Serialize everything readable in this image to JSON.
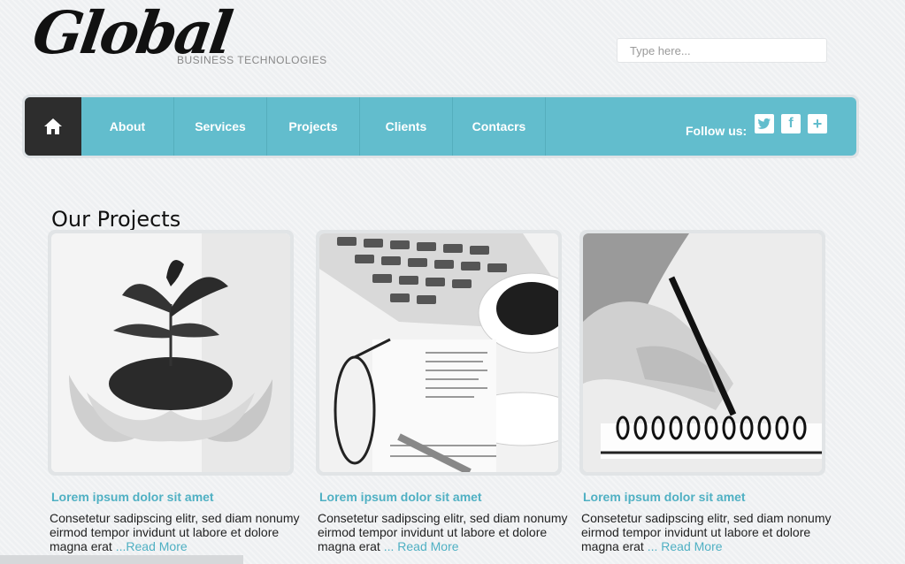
{
  "header": {
    "logo_text": "Global",
    "tagline": "BUSINESS TECHNOLOGIES",
    "search_placeholder": "Type here..."
  },
  "nav": {
    "home_icon": "home-icon",
    "items": [
      {
        "label": "About"
      },
      {
        "label": "Services"
      },
      {
        "label": "Projects"
      },
      {
        "label": "Clients"
      },
      {
        "label": "Contacrs"
      }
    ],
    "follow_label": "Follow us:",
    "social": [
      {
        "icon": "twitter-icon",
        "glyph": "t"
      },
      {
        "icon": "facebook-icon",
        "glyph": "f"
      },
      {
        "icon": "plus-icon",
        "glyph": "+"
      }
    ]
  },
  "projects": {
    "title": "Our Projects",
    "cards": [
      {
        "image": "plant-in-hands-photo",
        "title": "Lorem ipsum dolor sit amet",
        "text": "Consetetur sadipscing elitr, sed diam nonumy eirmod tempor invidunt ut labore et dolore magna erat ",
        "read_more": "...Read More"
      },
      {
        "image": "calculator-coffee-glasses-photo",
        "title": "Lorem ipsum dolor sit amet",
        "text": "Consetetur sadipscing elitr, sed diam nonumy eirmod tempor invidunt ut labore et dolore magna erat ",
        "read_more": "... Read More"
      },
      {
        "image": "hand-writing-notebook-photo",
        "title": "Lorem ipsum dolor sit amet",
        "text": "Consetetur sadipscing elitr, sed diam nonumy eirmod tempor invidunt ut labore et dolore magna erat ",
        "read_more": "... Read More"
      }
    ]
  },
  "colors": {
    "accent": "#62bdcd",
    "link": "#4fb0c3",
    "home_bg": "#2d2d2d"
  }
}
